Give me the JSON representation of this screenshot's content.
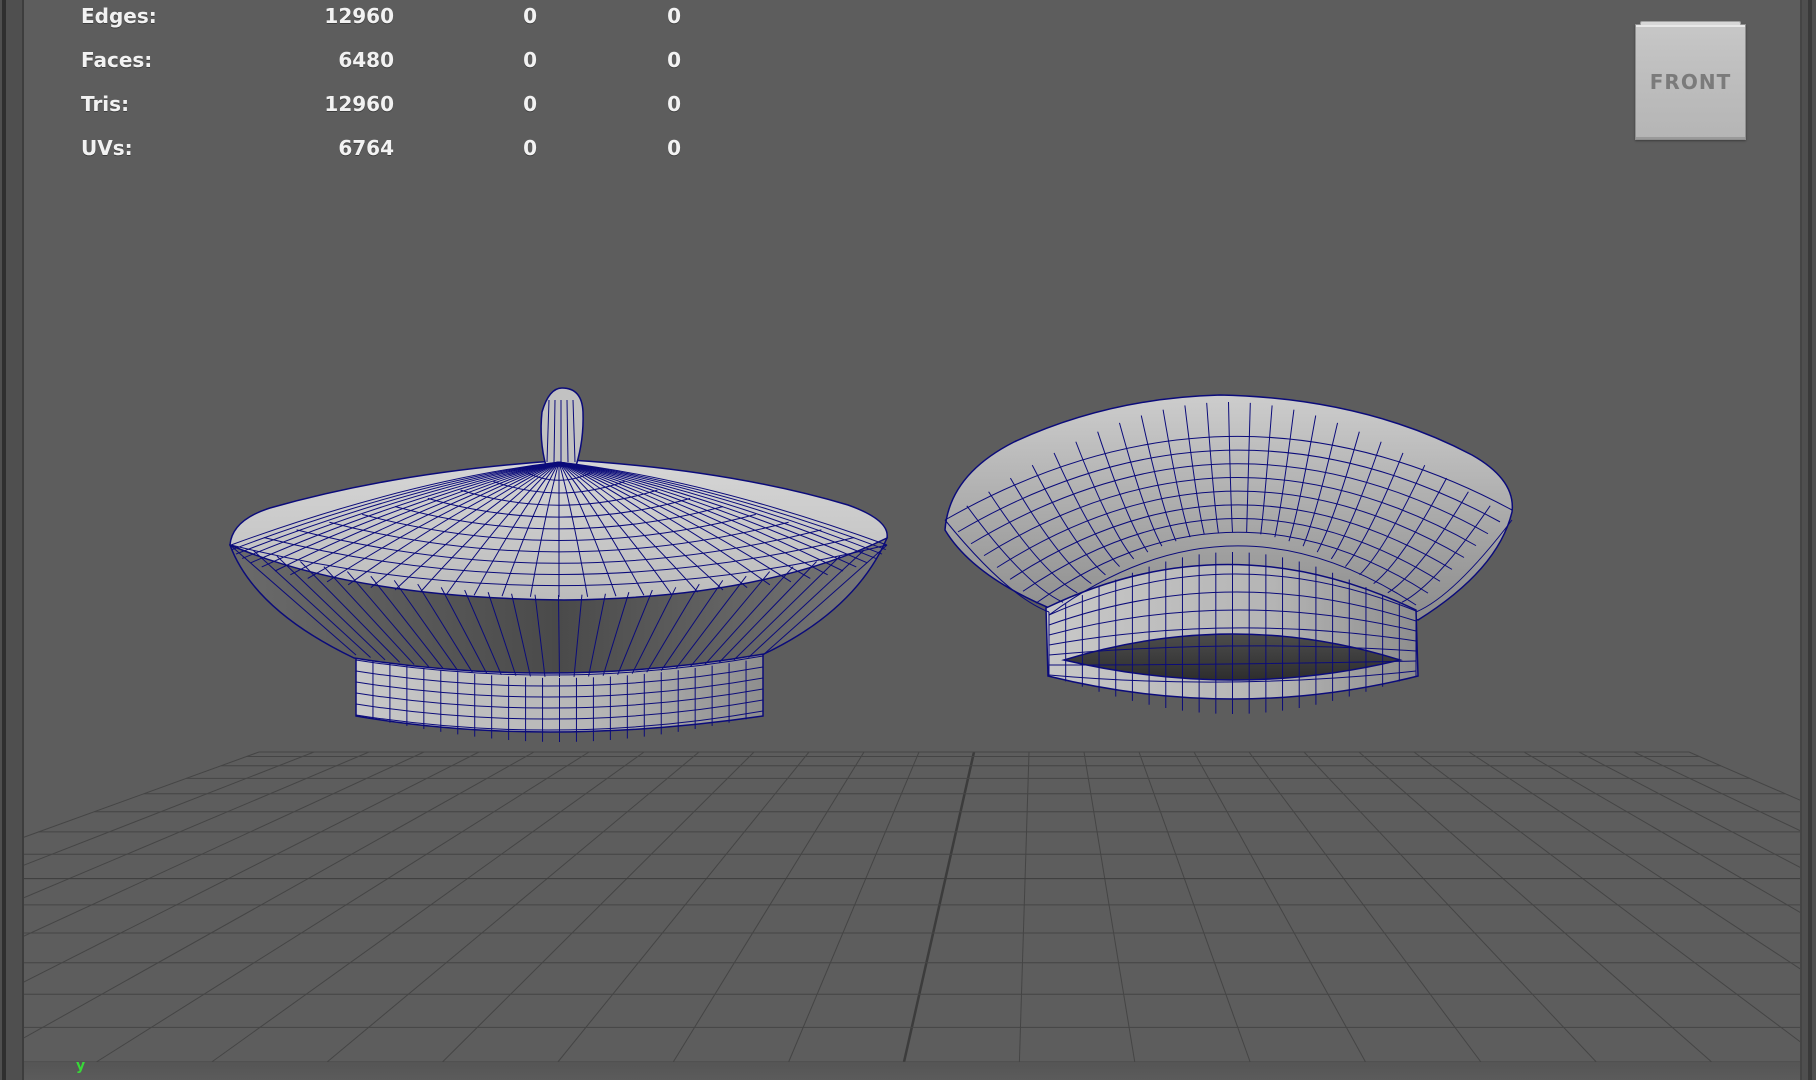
{
  "viewport": {
    "camera_name": "FRONT",
    "stats": [
      {
        "label": "Edges:",
        "v1": "12960",
        "v2": "0",
        "v3": "0"
      },
      {
        "label": "Faces:",
        "v1": "6480",
        "v2": "0",
        "v3": "0"
      },
      {
        "label": "Tris:",
        "v1": "12960",
        "v2": "0",
        "v3": "0"
      },
      {
        "label": "UVs:",
        "v1": "6764",
        "v2": "0",
        "v3": "0"
      }
    ],
    "axis_indicator": "y",
    "wireframe_color": "#0b0b7a",
    "grid_color": "#454545",
    "axis_line_color": "#3c3c3c"
  }
}
